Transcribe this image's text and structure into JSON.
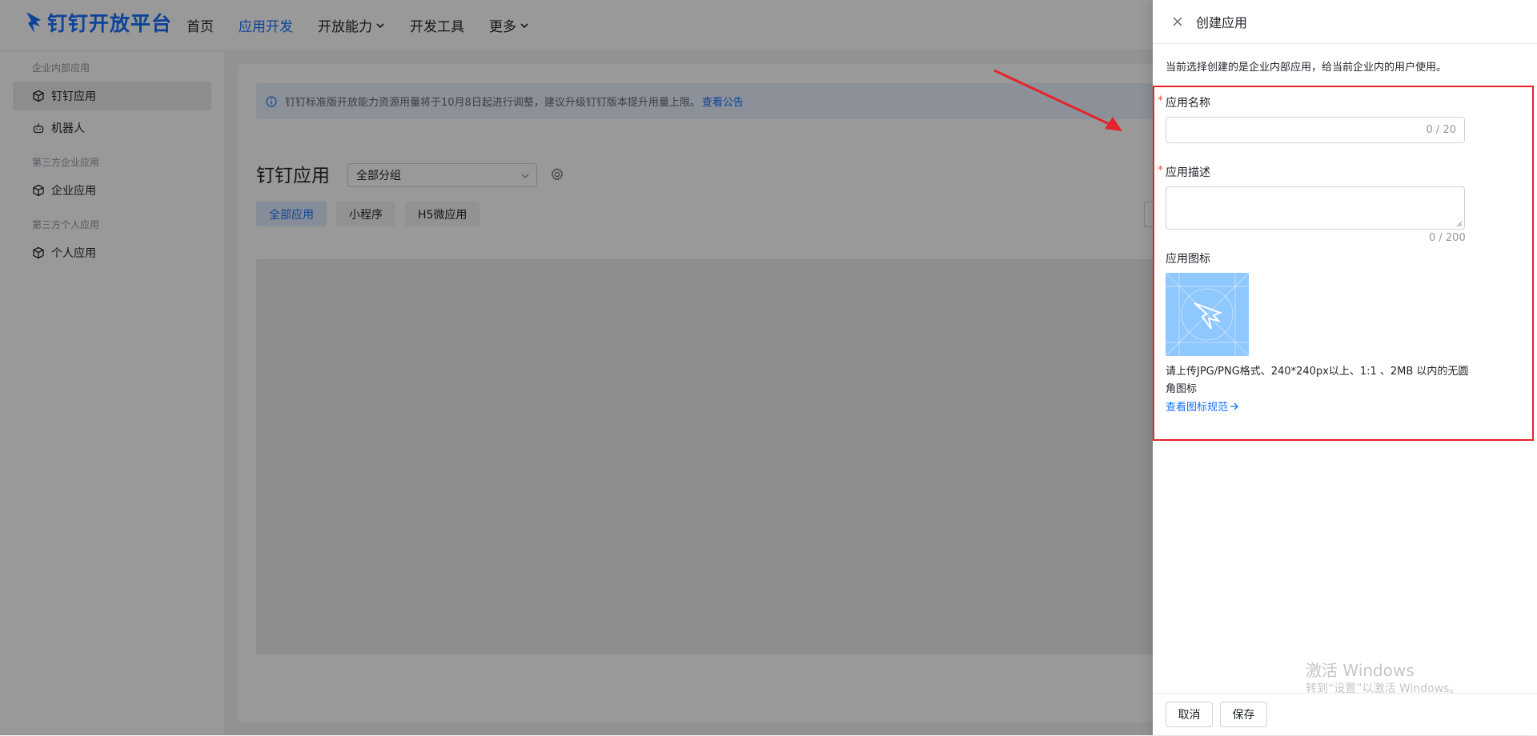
{
  "header": {
    "logo_text": "钉钉开放平台",
    "nav": [
      {
        "label": "首页",
        "active": false,
        "dropdown": false
      },
      {
        "label": "应用开发",
        "active": true,
        "dropdown": false
      },
      {
        "label": "开放能力",
        "active": false,
        "dropdown": true
      },
      {
        "label": "开发工具",
        "active": false,
        "dropdown": false
      },
      {
        "label": "更多",
        "active": false,
        "dropdown": true
      }
    ]
  },
  "sidebar": {
    "group1": "企业内部应用",
    "item_dingtalk": "钉钉应用",
    "item_robot": "机器人",
    "group2": "第三方企业应用",
    "item_enterprise": "企业应用",
    "group3": "第三方个人应用",
    "item_personal": "个人应用"
  },
  "main": {
    "notice_text": "钉钉标准版开放能力资源用量将于10月8日起进行调整，建议升级钉钉版本提升用量上限。",
    "notice_link": "查看公告",
    "title": "钉钉应用",
    "group_select": "全部分组",
    "tabs": [
      "全部应用",
      "小程序",
      "H5微应用"
    ]
  },
  "drawer": {
    "title": "创建应用",
    "tip": "当前选择创建的是企业内部应用，给当前企业内的用户使用。",
    "name_label": "应用名称",
    "name_counter": "0 / 20",
    "desc_label": "应用描述",
    "desc_counter": "0 / 200",
    "icon_label": "应用图标",
    "upload_help": "请上传JPG/PNG格式、240*240px以上、1:1 、2MB 以内的无圆角图标",
    "spec_link": "查看图标规范",
    "watermark_title": "激活 Windows",
    "watermark_sub": "转到“设置”以激活 Windows。",
    "cancel": "取消",
    "save": "保存"
  },
  "colors": {
    "brand": "#1671ff",
    "annotation": "#e5242b",
    "icon_bg": "#8fc7ff"
  }
}
